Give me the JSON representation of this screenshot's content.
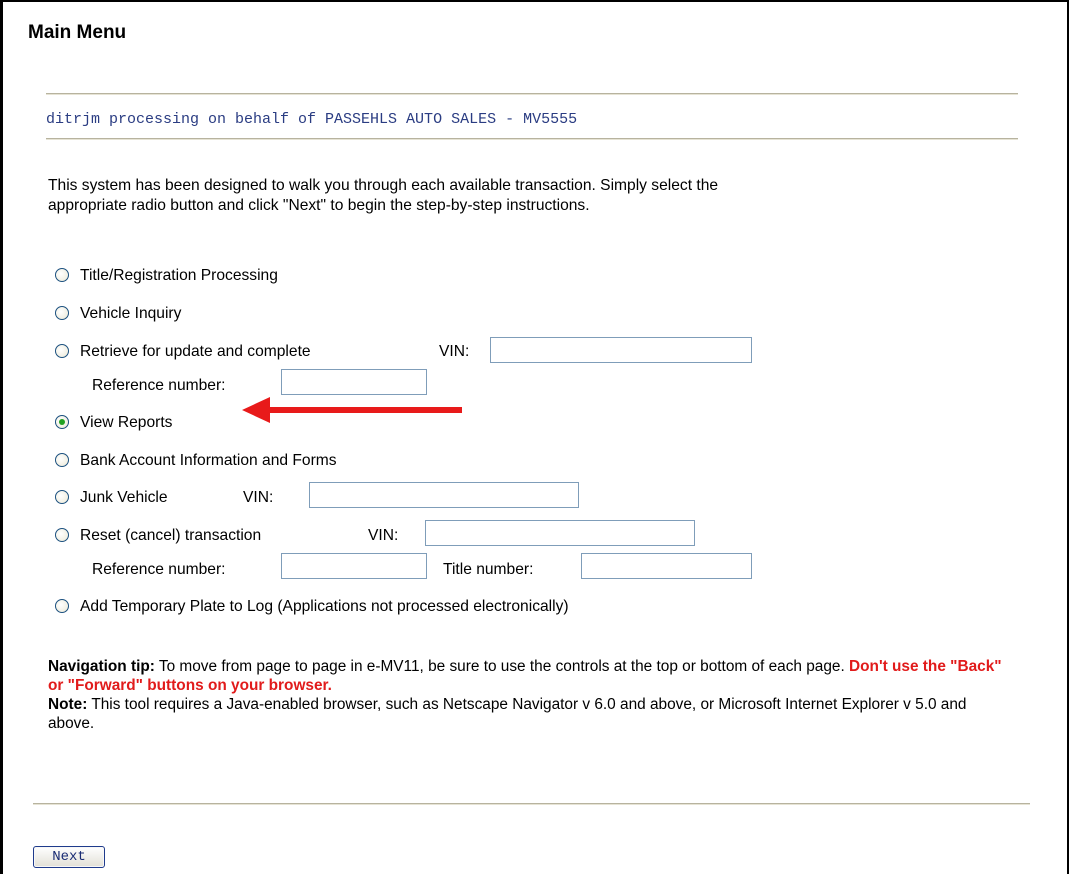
{
  "page": {
    "title": "Main Menu",
    "processing_text": "ditrjm processing on behalf of PASSEHLS AUTO SALES - MV5555",
    "intro_line1": "This system has been designed to walk you through each available transaction. Simply select the",
    "intro_line2": "appropriate radio button and click \"Next\" to begin the step-by-step instructions."
  },
  "options": {
    "title_registration": {
      "label": "Title/Registration Processing",
      "selected": false
    },
    "vehicle_inquiry": {
      "label": "Vehicle Inquiry",
      "selected": false
    },
    "retrieve_update": {
      "label": "Retrieve for update and complete",
      "selected": false,
      "vin_label": "VIN:",
      "vin_value": "",
      "ref_label": "Reference number:",
      "ref_value": ""
    },
    "view_reports": {
      "label": "View Reports",
      "selected": true
    },
    "bank_account": {
      "label": "Bank Account Information and Forms",
      "selected": false
    },
    "junk_vehicle": {
      "label": "Junk Vehicle",
      "selected": false,
      "vin_label": "VIN:",
      "vin_value": ""
    },
    "reset_transaction": {
      "label": "Reset (cancel) transaction",
      "selected": false,
      "vin_label": "VIN:",
      "vin_value": "",
      "ref_label": "Reference number:",
      "ref_value": "",
      "title_label": "Title number:",
      "title_value": ""
    },
    "temp_plate": {
      "label": "Add Temporary Plate to Log (Applications not processed electronically)",
      "selected": false
    }
  },
  "tips": {
    "nav_tip_label": "Navigation tip:",
    "nav_tip_text": " To move from page to page in e-MV11, be sure to use the controls at the top or bottom of each page. ",
    "nav_tip_warning": "Don't use the \"Back\" or \"Forward\" buttons on your browser.",
    "note_label": "Note:",
    "note_text": " This tool requires a Java-enabled browser, such as Netscape Navigator v 6.0 and above, or Microsoft Internet Explorer v 5.0 and above."
  },
  "buttons": {
    "next_label": "Next"
  },
  "colors": {
    "arrow": "#e81a1a",
    "warning": "#e11b1b",
    "processing_text": "#2a3c82",
    "radio_selected": "#21a121"
  },
  "icons": {
    "annotation_arrow": "red-left-arrow-icon"
  }
}
